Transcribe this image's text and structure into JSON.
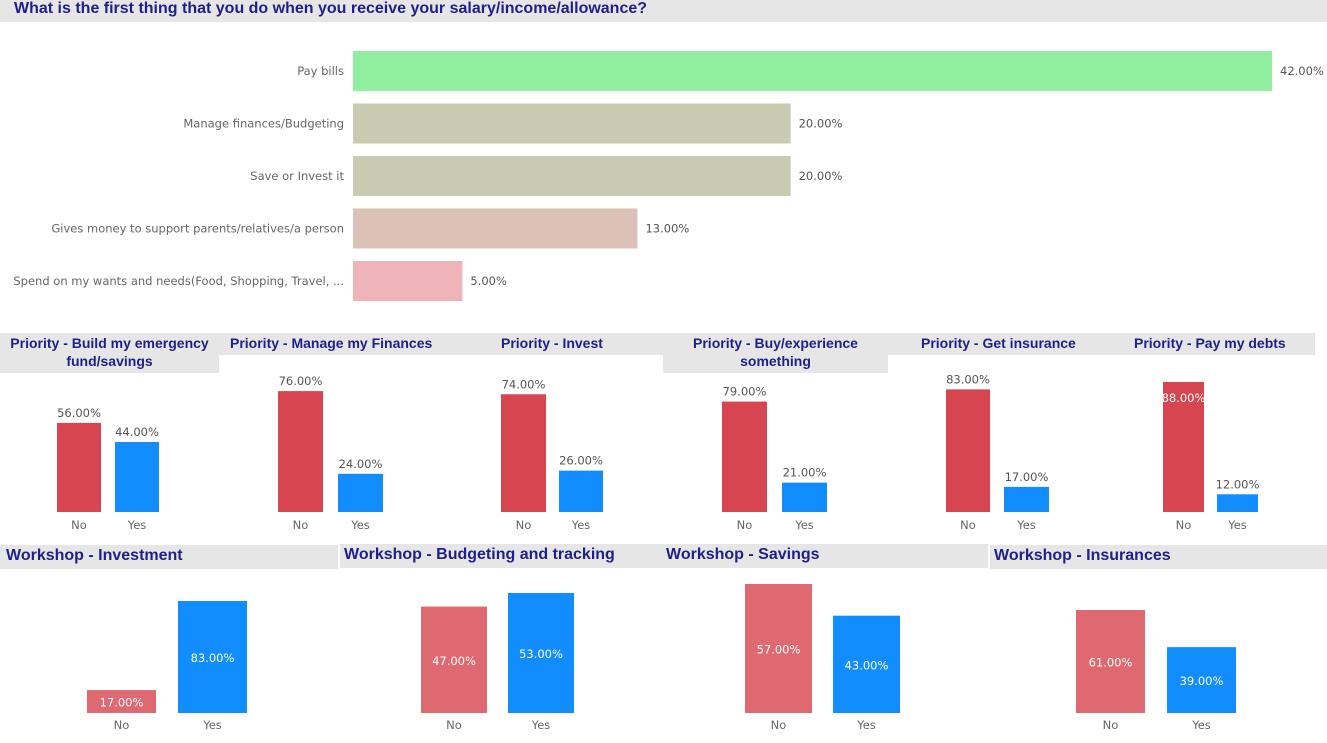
{
  "colors": {
    "title": "#1f1f8c",
    "band": "#e6e6e6",
    "no_priority": "#d64550",
    "no_workshop": "#df6970",
    "yes": "#118dff",
    "axis_text": "#666666",
    "label_text": "#555555"
  },
  "chart_data": [
    {
      "id": "main",
      "type": "bar",
      "orientation": "horizontal",
      "title": "What is the first thing that you do when you receive your salary/income/allowance?",
      "categories": [
        "Pay bills",
        "Manage finances/Budgeting",
        "Save or Invest it",
        "Gives money to support parents/relatives/a person",
        "Spend on my wants and needs(Food, Shopping, Travel, ..."
      ],
      "values": [
        42,
        20,
        20,
        13,
        5
      ],
      "labels": [
        "42.00%",
        "20.00%",
        "20.00%",
        "13.00%",
        "5.00%"
      ],
      "colors": [
        "#90ee9f",
        "#c8cbb2",
        "#c8cbb2",
        "#dbc1b6",
        "#efb4b9"
      ],
      "xlim": [
        0,
        42
      ],
      "grid": false
    },
    {
      "id": "p1",
      "type": "bar",
      "title": "Priority - Build my emergency fund/savings",
      "categories": [
        "No",
        "Yes"
      ],
      "values": [
        56,
        44
      ],
      "labels": [
        "56.00%",
        "44.00%"
      ],
      "ylim": [
        0,
        88
      ]
    },
    {
      "id": "p2",
      "type": "bar",
      "title": "Priority - Manage my Finances",
      "categories": [
        "No",
        "Yes"
      ],
      "values": [
        76,
        24
      ],
      "labels": [
        "76.00%",
        "24.00%"
      ],
      "ylim": [
        0,
        88
      ]
    },
    {
      "id": "p3",
      "type": "bar",
      "title": "Priority - Invest",
      "categories": [
        "No",
        "Yes"
      ],
      "values": [
        74,
        26
      ],
      "labels": [
        "74.00%",
        "26.00%"
      ],
      "ylim": [
        0,
        88
      ]
    },
    {
      "id": "p4",
      "type": "bar",
      "title": "Priority - Buy/experience something",
      "categories": [
        "No",
        "Yes"
      ],
      "values": [
        79,
        21
      ],
      "labels": [
        "79.00%",
        "21.00%"
      ],
      "ylim": [
        0,
        88
      ]
    },
    {
      "id": "p5",
      "type": "bar",
      "title": "Priority - Get insurance",
      "categories": [
        "No",
        "Yes"
      ],
      "values": [
        83,
        17
      ],
      "labels": [
        "83.00%",
        "17.00%"
      ],
      "ylim": [
        0,
        88
      ]
    },
    {
      "id": "p6",
      "type": "bar",
      "title": "Priority - Pay my debts",
      "categories": [
        "No",
        "Yes"
      ],
      "values": [
        88,
        12
      ],
      "labels": [
        "88.00%",
        "12.00%"
      ],
      "ylim": [
        0,
        88
      ]
    },
    {
      "id": "w1",
      "type": "bar",
      "title": "Workshop - Investment",
      "categories": [
        "No",
        "Yes"
      ],
      "values": [
        17,
        83
      ],
      "labels": [
        "17.00%",
        "83.00%"
      ],
      "ylim": [
        0,
        83
      ]
    },
    {
      "id": "w2",
      "type": "bar",
      "title": "Workshop - Budgeting and tracking",
      "categories": [
        "No",
        "Yes"
      ],
      "values": [
        47,
        53
      ],
      "labels": [
        "47.00%",
        "53.00%"
      ],
      "ylim": [
        0,
        53
      ]
    },
    {
      "id": "w3",
      "type": "bar",
      "title": "Workshop - Savings",
      "categories": [
        "No",
        "Yes"
      ],
      "values": [
        57,
        43
      ],
      "labels": [
        "57.00%",
        "43.00%"
      ],
      "ylim": [
        0,
        57
      ]
    },
    {
      "id": "w4",
      "type": "bar",
      "title": "Workshop - Insurances",
      "categories": [
        "No",
        "Yes"
      ],
      "values": [
        61,
        39
      ],
      "labels": [
        "61.00%",
        "39.00%"
      ],
      "ylim": [
        0,
        61
      ]
    }
  ]
}
